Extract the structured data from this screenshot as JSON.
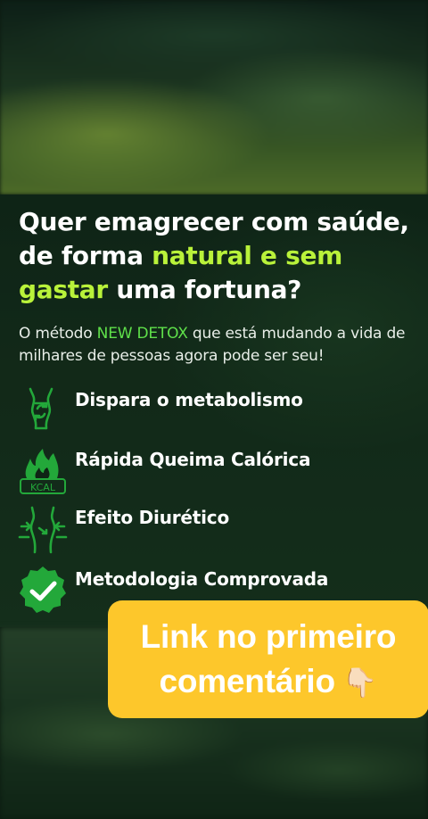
{
  "headline": {
    "line1": "Quer emagrecer com saúde,",
    "line2_prefix": "de forma ",
    "line2_highlight": "natural e sem",
    "line3_highlight": "gastar",
    "line3_suffix": " uma fortuna?"
  },
  "subtext": {
    "prefix": "O método ",
    "highlight": "NEW DETOX",
    "suffix": " que está mudando a vida de milhares de pessoas agora pode ser seu!"
  },
  "features": [
    {
      "label": "Dispara o metabolismo",
      "icon": "body-metabolism-icon"
    },
    {
      "label": "Rápida Queima Calórica",
      "icon": "kcal-flame-icon"
    },
    {
      "label": "Efeito Diurético",
      "icon": "waist-diuretic-icon"
    },
    {
      "label": "Metodologia Comprovada",
      "icon": "check-badge-icon"
    }
  ],
  "cta": {
    "line1": "Link no primeiro",
    "line2": "comentário",
    "emoji": "👇🏻"
  },
  "colors": {
    "accent_green": "#b9f23a",
    "brand_green": "#5fe04a",
    "icon_green": "#23a83a",
    "cta_yellow": "#fdc72b"
  },
  "icon_text": {
    "kcal": "KCAL"
  }
}
